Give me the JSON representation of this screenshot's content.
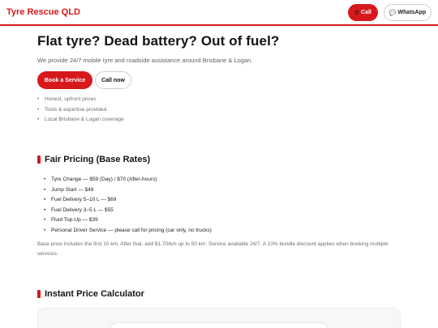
{
  "header": {
    "brand": "Tyre Rescue QLD",
    "call_label": "Call",
    "whatsapp_label": "WhatsApp",
    "call_icon": "phone-icon",
    "whatsapp_icon": "chat-bubble-icon",
    "accent_color": "#d7191c"
  },
  "hero": {
    "title": "Flat tyre? Dead battery? Out of fuel?",
    "subtitle": "We provide 24/7 mobile tyre and roadside assistance around Brisbane & Logan.",
    "book_label": "Book a Service",
    "callnow_label": "Call now",
    "features": [
      "Honest, upfront prices",
      "Tools & expertise provided",
      "Local Brisbane & Logan coverage"
    ]
  },
  "pricing": {
    "title": "Fair Pricing (Base Rates)",
    "items": [
      "Tyre Change — $59 (Day) / $70 (After-hours)",
      "Jump Start — $49",
      "Fuel Delivery 5–10 L — $69",
      "Fuel Delivery 3–5 L — $55",
      "Fluid Top-Up — $39",
      "Personal Driver Service — please call for pricing (car only, no trucks)"
    ],
    "note": "Base price includes the first 10 km. After that, add $1.70/km up to 50 km. Service available 24/7. A 10% bundle discount applies when booking multiple services."
  },
  "calculator": {
    "title": "Instant Price Calculator"
  }
}
